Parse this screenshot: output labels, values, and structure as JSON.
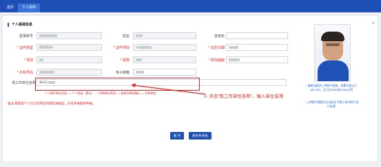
{
  "nav": {
    "tabs": [
      {
        "label": "首页",
        "active": false
      },
      {
        "label": "个人资料",
        "active": true
      }
    ]
  },
  "section": {
    "title": "个人基础信息"
  },
  "fields": {
    "login": {
      "label": "登录账号",
      "value": ""
    },
    "name": {
      "label": "姓名",
      "value": ""
    },
    "former_name": {
      "label": "曾用名",
      "value": ""
    },
    "id_type": {
      "label": "* 证件类型",
      "value": "居民身份证"
    },
    "id_number": {
      "label": "* 证件号码",
      "value": "4"
    },
    "birth_date": {
      "label": "* 出生日期",
      "value": ""
    },
    "gender": {
      "label": "* 性别",
      "value": ""
    },
    "ethnicity": {
      "label": "* 民族",
      "value": ""
    },
    "political": {
      "label": "* 政治面貌",
      "value": ""
    },
    "phone": {
      "label": "* 手机号码",
      "value": ""
    },
    "email": {
      "label": "电子邮箱",
      "value": ""
    },
    "current_unit": {
      "label": "现工作单位名称",
      "value": "嘉祥县"
    }
  },
  "flow_text": "个人填写单位信息---> 个人承诺（提交）---> 所审单位承诺---> 新单位审核确认---> 信息审定",
  "annotation": "3. 点击“现工作单位名称”，输入单位名称",
  "note": "备注:需完成个人与工作单位的绑定关联后，方可开展职称申报。",
  "photo_note": "* 请按证要求上传照片图册，须需不超过于 300*180，大小在20kb到200kb之间",
  "photo_link": "* 上传图片需要先点击此处下载工具对照片进行处理",
  "buttons": {
    "save": "暂 存",
    "save_next": "保存并开始"
  },
  "colors": {
    "accent": "#1e4fb5",
    "alert": "#e02020",
    "link": "#1e66d6"
  }
}
